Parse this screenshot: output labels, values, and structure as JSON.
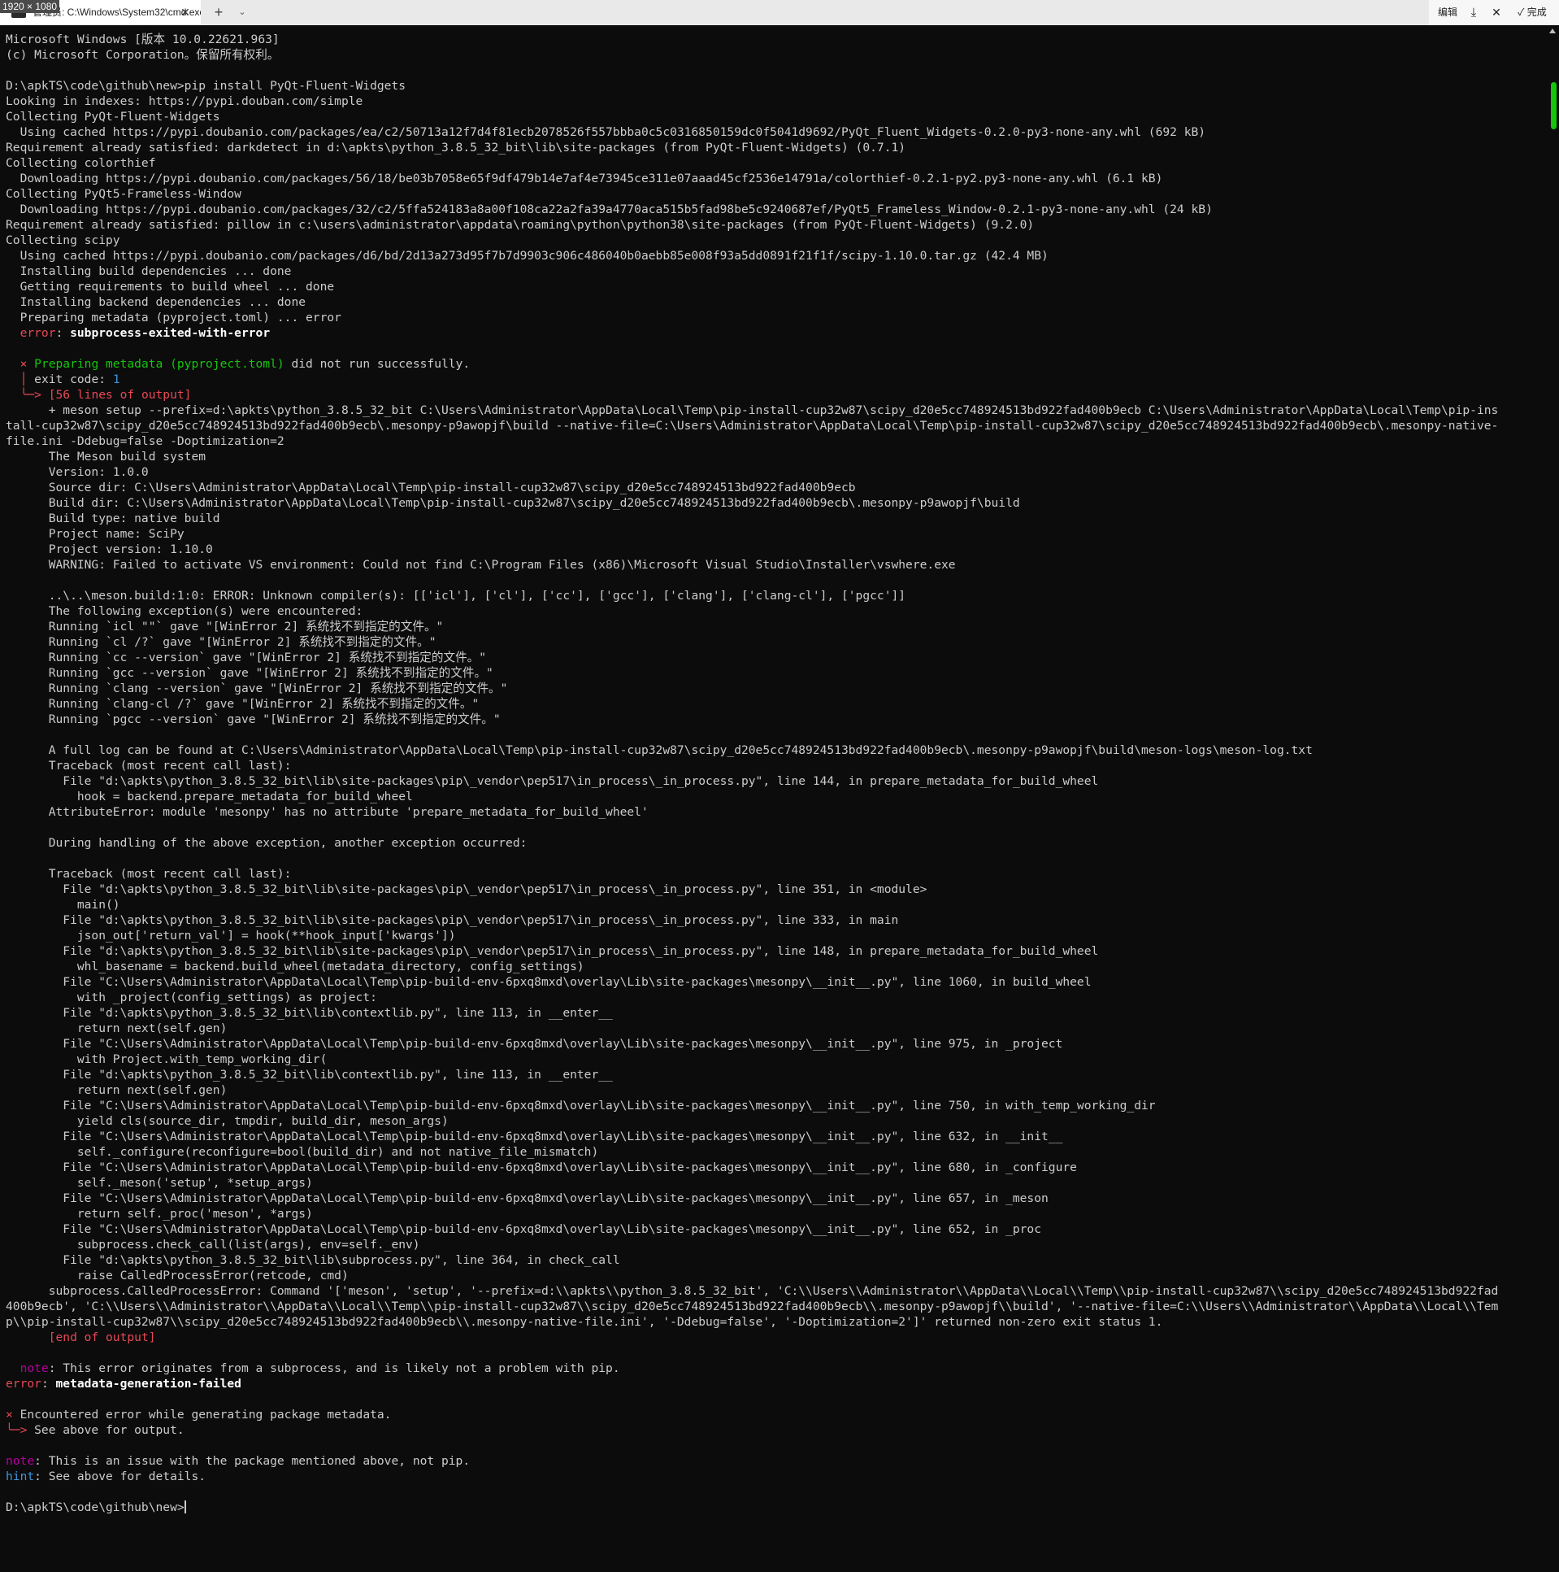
{
  "window": {
    "size_badge": "1920 × 1080",
    "tab_title": "管理员: C:\\Windows\\System32\\cmd.exe",
    "new_tab": "+",
    "tab_dropdown": "⌄",
    "close_glyph": "✕",
    "toolbar": {
      "edit": "编辑",
      "download": "⤓",
      "close": "✕",
      "done": "✓ 完成"
    }
  },
  "colors": {
    "background": "#0c0c0c",
    "foreground": "#cccccc",
    "error_red": "#e74856",
    "success_green": "#16c60c",
    "note_magenta": "#b4009e",
    "hint_cyan": "#3a96dd"
  },
  "prompt": "D:\\apkTS\\code\\github\\new>",
  "lines": [
    "Microsoft Windows [版本 10.0.22621.963]",
    "(c) Microsoft Corporation。保留所有权利。",
    "",
    "D:\\apkTS\\code\\github\\new>pip install PyQt-Fluent-Widgets",
    "Looking in indexes: https://pypi.douban.com/simple",
    "Collecting PyQt-Fluent-Widgets",
    "  Using cached https://pypi.doubanio.com/packages/ea/c2/50713a12f7d4f81ecb2078526f557bbba0c5c0316850159dc0f5041d9692/PyQt_Fluent_Widgets-0.2.0-py3-none-any.whl (692 kB)",
    "Requirement already satisfied: darkdetect in d:\\apkts\\python_3.8.5_32_bit\\lib\\site-packages (from PyQt-Fluent-Widgets) (0.7.1)",
    "Collecting colorthief",
    "  Downloading https://pypi.doubanio.com/packages/56/18/be03b7058e65f9df479b14e7af4e73945ce311e07aaad45cf2536e14791a/colorthief-0.2.1-py2.py3-none-any.whl (6.1 kB)",
    "Collecting PyQt5-Frameless-Window",
    "  Downloading https://pypi.doubanio.com/packages/32/c2/5ffa524183a8a00f108ca22a2fa39a4770aca515b5fad98be5c9240687ef/PyQt5_Frameless_Window-0.2.1-py3-none-any.whl (24 kB)",
    "Requirement already satisfied: pillow in c:\\users\\administrator\\appdata\\roaming\\python\\python38\\site-packages (from PyQt-Fluent-Widgets) (9.2.0)",
    "Collecting scipy",
    "  Using cached https://pypi.doubanio.com/packages/d6/bd/2d13a273d95f7b7d9903c906c486040b0aebb85e008f93a5dd0891f21f1f/scipy-1.10.0.tar.gz (42.4 MB)",
    "  Installing build dependencies ... done",
    "  Getting requirements to build wheel ... done",
    "  Installing backend dependencies ... done",
    "  Preparing metadata (pyproject.toml) ... error",
    "  error: subprocess-exited-with-error",
    "",
    "  × Preparing metadata (pyproject.toml) did not run successfully.",
    "  │ exit code: 1",
    "  ╰─> [56 lines of output]",
    "      + meson setup --prefix=d:\\apkts\\python_3.8.5_32_bit C:\\Users\\Administrator\\AppData\\Local\\Temp\\pip-install-cup32w87\\scipy_d20e5cc748924513bd922fad400b9ecb C:\\Users\\Administrator\\AppData\\Local\\Temp\\pip-ins",
    "tall-cup32w87\\scipy_d20e5cc748924513bd922fad400b9ecb\\.mesonpy-p9awopjf\\build --native-file=C:\\Users\\Administrator\\AppData\\Local\\Temp\\pip-install-cup32w87\\scipy_d20e5cc748924513bd922fad400b9ecb\\.mesonpy-native-",
    "file.ini -Ddebug=false -Doptimization=2",
    "      The Meson build system",
    "      Version: 1.0.0",
    "      Source dir: C:\\Users\\Administrator\\AppData\\Local\\Temp\\pip-install-cup32w87\\scipy_d20e5cc748924513bd922fad400b9ecb",
    "      Build dir: C:\\Users\\Administrator\\AppData\\Local\\Temp\\pip-install-cup32w87\\scipy_d20e5cc748924513bd922fad400b9ecb\\.mesonpy-p9awopjf\\build",
    "      Build type: native build",
    "      Project name: SciPy",
    "      Project version: 1.10.0",
    "      WARNING: Failed to activate VS environment: Could not find C:\\Program Files (x86)\\Microsoft Visual Studio\\Installer\\vswhere.exe",
    "",
    "      ..\\..\\meson.build:1:0: ERROR: Unknown compiler(s): [['icl'], ['cl'], ['cc'], ['gcc'], ['clang'], ['clang-cl'], ['pgcc']]",
    "      The following exception(s) were encountered:",
    "      Running `icl \"\"` gave \"[WinError 2] 系统找不到指定的文件。\"",
    "      Running `cl /?` gave \"[WinError 2] 系统找不到指定的文件。\"",
    "      Running `cc --version` gave \"[WinError 2] 系统找不到指定的文件。\"",
    "      Running `gcc --version` gave \"[WinError 2] 系统找不到指定的文件。\"",
    "      Running `clang --version` gave \"[WinError 2] 系统找不到指定的文件。\"",
    "      Running `clang-cl /?` gave \"[WinError 2] 系统找不到指定的文件。\"",
    "      Running `pgcc --version` gave \"[WinError 2] 系统找不到指定的文件。\"",
    "",
    "      A full log can be found at C:\\Users\\Administrator\\AppData\\Local\\Temp\\pip-install-cup32w87\\scipy_d20e5cc748924513bd922fad400b9ecb\\.mesonpy-p9awopjf\\build\\meson-logs\\meson-log.txt",
    "      Traceback (most recent call last):",
    "        File \"d:\\apkts\\python_3.8.5_32_bit\\lib\\site-packages\\pip\\_vendor\\pep517\\in_process\\_in_process.py\", line 144, in prepare_metadata_for_build_wheel",
    "          hook = backend.prepare_metadata_for_build_wheel",
    "      AttributeError: module 'mesonpy' has no attribute 'prepare_metadata_for_build_wheel'",
    "",
    "      During handling of the above exception, another exception occurred:",
    "",
    "      Traceback (most recent call last):",
    "        File \"d:\\apkts\\python_3.8.5_32_bit\\lib\\site-packages\\pip\\_vendor\\pep517\\in_process\\_in_process.py\", line 351, in <module>",
    "          main()",
    "        File \"d:\\apkts\\python_3.8.5_32_bit\\lib\\site-packages\\pip\\_vendor\\pep517\\in_process\\_in_process.py\", line 333, in main",
    "          json_out['return_val'] = hook(**hook_input['kwargs'])",
    "        File \"d:\\apkts\\python_3.8.5_32_bit\\lib\\site-packages\\pip\\_vendor\\pep517\\in_process\\_in_process.py\", line 148, in prepare_metadata_for_build_wheel",
    "          whl_basename = backend.build_wheel(metadata_directory, config_settings)",
    "        File \"C:\\Users\\Administrator\\AppData\\Local\\Temp\\pip-build-env-6pxq8mxd\\overlay\\Lib\\site-packages\\mesonpy\\__init__.py\", line 1060, in build_wheel",
    "          with _project(config_settings) as project:",
    "        File \"d:\\apkts\\python_3.8.5_32_bit\\lib\\contextlib.py\", line 113, in __enter__",
    "          return next(self.gen)",
    "        File \"C:\\Users\\Administrator\\AppData\\Local\\Temp\\pip-build-env-6pxq8mxd\\overlay\\Lib\\site-packages\\mesonpy\\__init__.py\", line 975, in _project",
    "          with Project.with_temp_working_dir(",
    "        File \"d:\\apkts\\python_3.8.5_32_bit\\lib\\contextlib.py\", line 113, in __enter__",
    "          return next(self.gen)",
    "        File \"C:\\Users\\Administrator\\AppData\\Local\\Temp\\pip-build-env-6pxq8mxd\\overlay\\Lib\\site-packages\\mesonpy\\__init__.py\", line 750, in with_temp_working_dir",
    "          yield cls(source_dir, tmpdir, build_dir, meson_args)",
    "        File \"C:\\Users\\Administrator\\AppData\\Local\\Temp\\pip-build-env-6pxq8mxd\\overlay\\Lib\\site-packages\\mesonpy\\__init__.py\", line 632, in __init__",
    "          self._configure(reconfigure=bool(build_dir) and not native_file_mismatch)",
    "        File \"C:\\Users\\Administrator\\AppData\\Local\\Temp\\pip-build-env-6pxq8mxd\\overlay\\Lib\\site-packages\\mesonpy\\__init__.py\", line 680, in _configure",
    "          self._meson('setup', *setup_args)",
    "        File \"C:\\Users\\Administrator\\AppData\\Local\\Temp\\pip-build-env-6pxq8mxd\\overlay\\Lib\\site-packages\\mesonpy\\__init__.py\", line 657, in _meson",
    "          return self._proc('meson', *args)",
    "        File \"C:\\Users\\Administrator\\AppData\\Local\\Temp\\pip-build-env-6pxq8mxd\\overlay\\Lib\\site-packages\\mesonpy\\__init__.py\", line 652, in _proc",
    "          subprocess.check_call(list(args), env=self._env)",
    "        File \"d:\\apkts\\python_3.8.5_32_bit\\lib\\subprocess.py\", line 364, in check_call",
    "          raise CalledProcessError(retcode, cmd)",
    "      subprocess.CalledProcessError: Command '['meson', 'setup', '--prefix=d:\\\\apkts\\\\python_3.8.5_32_bit', 'C:\\\\Users\\\\Administrator\\\\AppData\\\\Local\\\\Temp\\\\pip-install-cup32w87\\\\scipy_d20e5cc748924513bd922fad",
    "400b9ecb', 'C:\\\\Users\\\\Administrator\\\\AppData\\\\Local\\\\Temp\\\\pip-install-cup32w87\\\\scipy_d20e5cc748924513bd922fad400b9ecb\\\\.mesonpy-p9awopjf\\\\build', '--native-file=C:\\\\Users\\\\Administrator\\\\AppData\\\\Local\\\\Tem",
    "p\\\\pip-install-cup32w87\\\\scipy_d20e5cc748924513bd922fad400b9ecb\\\\.mesonpy-native-file.ini', '-Ddebug=false', '-Doptimization=2']' returned non-zero exit status 1.",
    "      [end of output]",
    "",
    "  note: This error originates from a subprocess, and is likely not a problem with pip.",
    "error: metadata-generation-failed",
    "",
    "× Encountered error while generating package metadata.",
    "╰─> See above for output.",
    "",
    "note: This is an issue with the package mentioned above, not pip.",
    "hint: See above for details.",
    ""
  ]
}
